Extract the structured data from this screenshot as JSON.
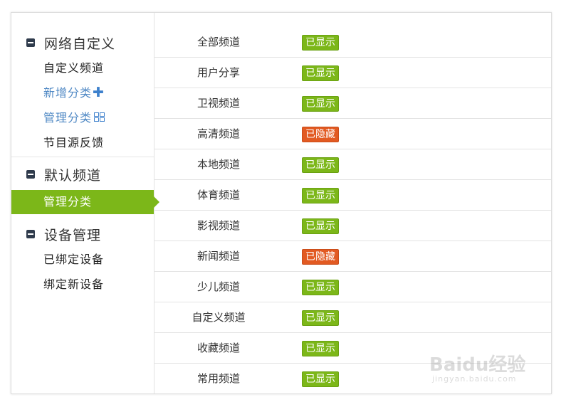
{
  "sidebar": {
    "groups": [
      {
        "title": "网络自定义",
        "items": [
          {
            "label": "自定义频道"
          },
          {
            "label": "新增分类"
          },
          {
            "label": "管理分类"
          },
          {
            "label": "节目源反馈"
          }
        ]
      },
      {
        "title": "默认频道",
        "items": [
          {
            "label": "管理分类",
            "active": true
          }
        ]
      },
      {
        "title": "设备管理",
        "items": [
          {
            "label": "已绑定设备"
          },
          {
            "label": "绑定新设备"
          }
        ]
      }
    ]
  },
  "channels": [
    {
      "name": "全部频道",
      "status": "已显示"
    },
    {
      "name": "用户分享",
      "status": "已显示"
    },
    {
      "name": "卫视频道",
      "status": "已显示"
    },
    {
      "name": "高清频道",
      "status": "已隐藏"
    },
    {
      "name": "本地频道",
      "status": "已显示"
    },
    {
      "name": "体育频道",
      "status": "已显示"
    },
    {
      "name": "影视频道",
      "status": "已显示"
    },
    {
      "name": "新闻频道",
      "status": "已隐藏"
    },
    {
      "name": "少儿频道",
      "status": "已显示"
    },
    {
      "name": "自定义频道",
      "status": "已显示"
    },
    {
      "name": "收藏频道",
      "status": "已显示"
    },
    {
      "name": "常用频道",
      "status": "已显示"
    }
  ],
  "colors": {
    "accent_green": "#7cb719",
    "hidden_orange": "#e25a22",
    "link_blue": "#4f88c4"
  },
  "watermark": {
    "main": "Baidu经验",
    "sub": "jingyan.baidu.com"
  }
}
